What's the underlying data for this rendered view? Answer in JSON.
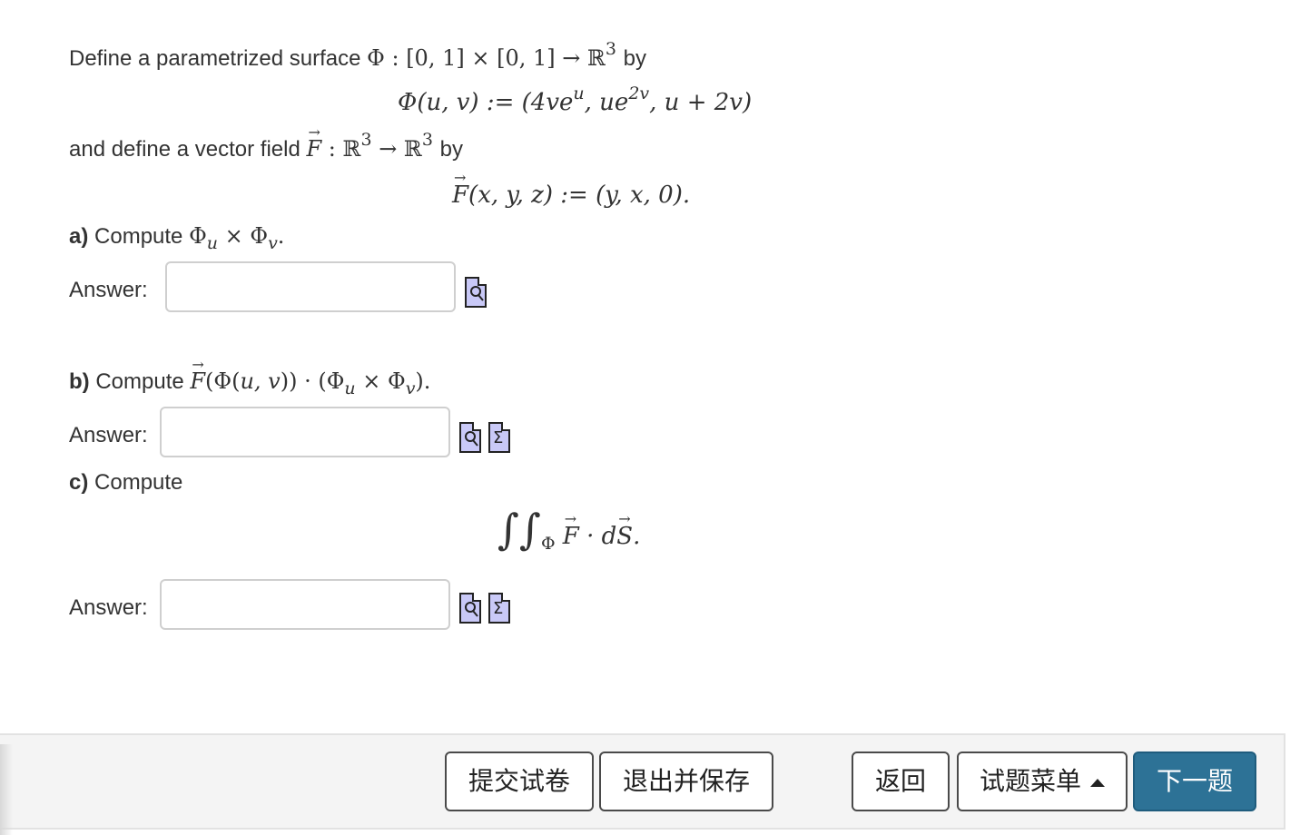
{
  "problem": {
    "intro_prefix": "Define a parametrized surface",
    "by": "by",
    "phi_def_lhs": "Φ(u, v) :=",
    "phi_def_rhs": "(4ve",
    "field_prefix": "and define a vector field",
    "field_def": "(x, y, z) := (y, x, 0)."
  },
  "parts": {
    "a": {
      "letter": "a)",
      "text": "Compute"
    },
    "b": {
      "letter": "b)",
      "text": "Compute"
    },
    "c": {
      "letter": "c)",
      "text": "Compute"
    }
  },
  "answer_label": "Answer:",
  "inputs": {
    "a": {
      "value": ""
    },
    "b": {
      "value": ""
    },
    "c": {
      "value": ""
    }
  },
  "icons": {
    "preview": "preview-icon",
    "equation": "equation-editor-icon"
  },
  "footer": {
    "submit_label": "提交试卷",
    "save_exit_label": "退出并保存",
    "back_label": "返回",
    "menu_label": "试题菜单",
    "next_label": "下一题"
  },
  "colors": {
    "primary": "#2d7296",
    "icon_fill": "#c9c9f7"
  }
}
